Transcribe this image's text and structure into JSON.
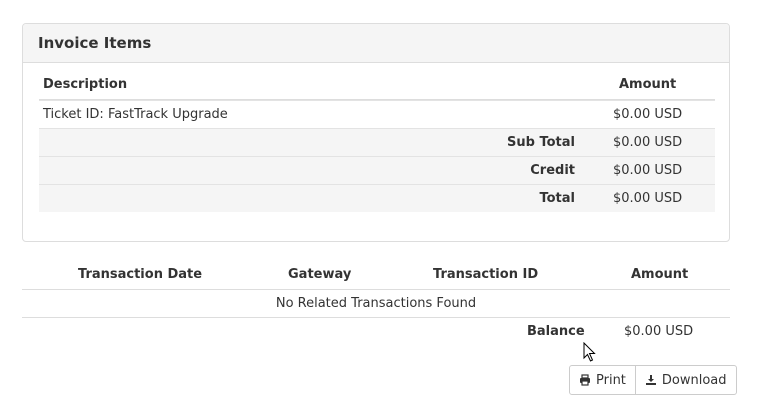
{
  "invoice_items": {
    "title": "Invoice Items",
    "columns": {
      "description": "Description",
      "amount": "Amount"
    },
    "rows": [
      {
        "description": "Ticket ID: FastTrack Upgrade",
        "amount": "$0.00 USD"
      }
    ],
    "totals": [
      {
        "label": "Sub Total",
        "amount": "$0.00 USD"
      },
      {
        "label": "Credit",
        "amount": "$0.00 USD"
      },
      {
        "label": "Total",
        "amount": "$0.00 USD"
      }
    ]
  },
  "transactions": {
    "columns": {
      "date": "Transaction Date",
      "gateway": "Gateway",
      "id": "Transaction ID",
      "amount": "Amount"
    },
    "empty_message": "No Related Transactions Found",
    "balance_label": "Balance",
    "balance_value": "$0.00 USD"
  },
  "actions": {
    "print_label": "Print",
    "download_label": "Download",
    "print_icon": "printer-icon",
    "download_icon": "download-icon"
  }
}
